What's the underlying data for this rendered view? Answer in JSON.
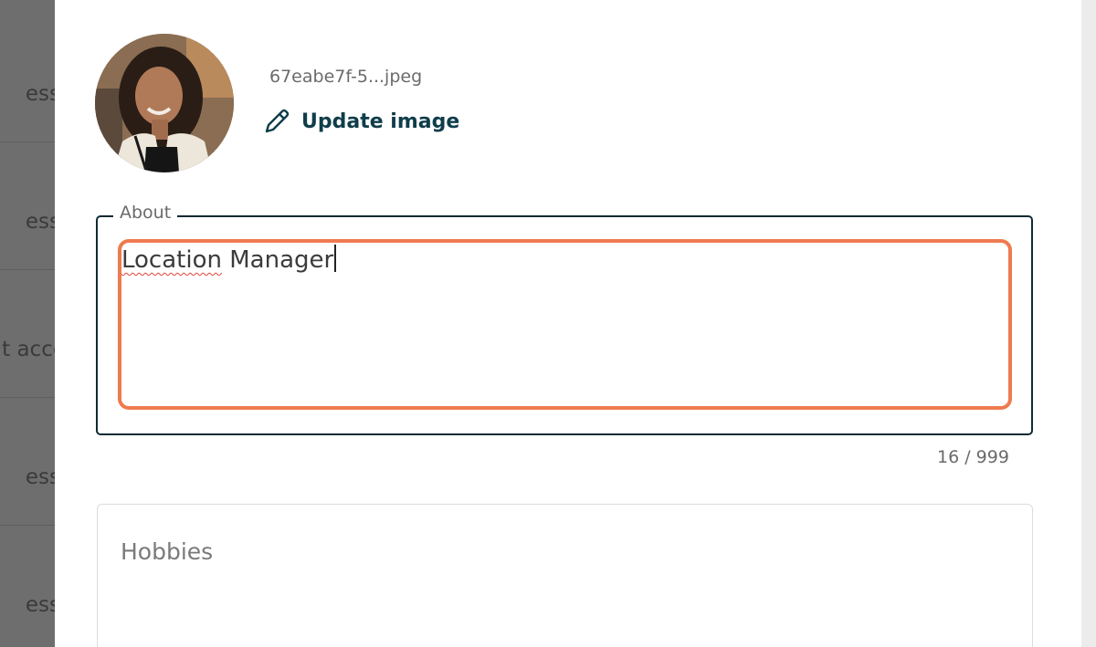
{
  "background_list": {
    "rows": [
      "ess",
      "ess",
      "t acce",
      "ess",
      "ess"
    ]
  },
  "profile": {
    "image_filename": "67eabe7f-5...jpeg",
    "update_image_label": "Update image"
  },
  "about": {
    "label": "About",
    "value_word1": "Location",
    "value_rest": " Manager",
    "counter": "16 / 999"
  },
  "hobbies": {
    "placeholder": "Hobbies"
  },
  "icons": {
    "edit": "pencil-icon"
  },
  "colors": {
    "brand_dark": "#0f3d4a",
    "highlight": "#ef7a4f",
    "spellcheck": "#e0463a"
  }
}
